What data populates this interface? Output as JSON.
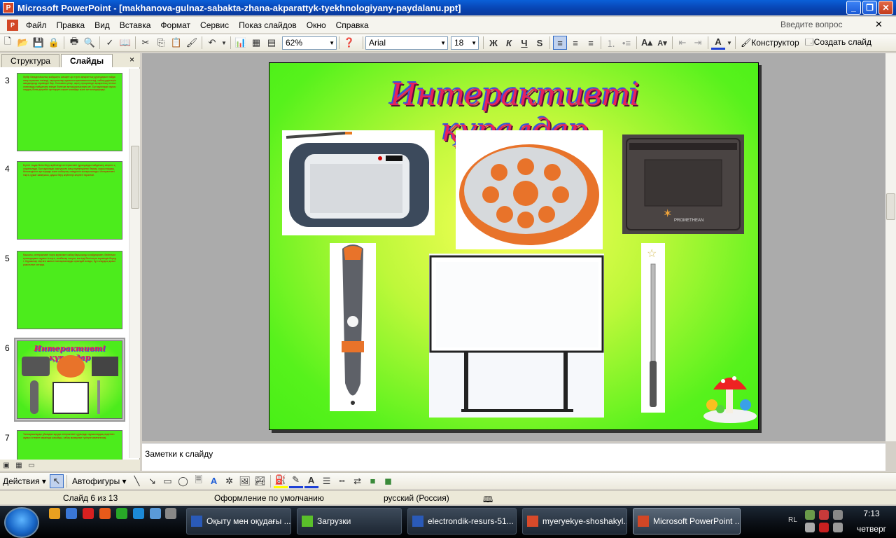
{
  "window": {
    "title": "Microsoft PowerPoint - [makhanova-gulnaz-sabakta-zhana-akparattyk-tyekhnologiyany-paydalanu.ppt]"
  },
  "menu": {
    "items": [
      "Файл",
      "Правка",
      "Вид",
      "Вставка",
      "Формат",
      "Сервис",
      "Показ слайдов",
      "Окно",
      "Справка"
    ],
    "help_placeholder": "Введите вопрос"
  },
  "toolbar": {
    "zoom": "62%",
    "font": "Arial",
    "size": "18",
    "bold": "Ж",
    "italic": "К",
    "underline": "Ч",
    "shadow": "S",
    "designer": "Конструктор",
    "new_slide": "Создать слайд"
  },
  "panel": {
    "tabs": [
      "Структура",
      "Слайды"
    ],
    "close": "×"
  },
  "thumbs": [
    {
      "num": "3",
      "text": "Әрбір бағдарламалық жабдықты шешуге әрі түрлі ақпараттық құралдарын пайдалану ықпалын тигізеді, оқытушылар жұмысын қамтамасыз етеді, сабақ үрдістерін жандандыру мүмкіндігі бар. Сонымен қатар, оқыту процесінде ақпараттық технологияларды пайдалану өзінде бірнеше артықшылықтарға ие. Бұл құралдар оқушылардың білім деңгейін арттыруға ықпал жасайды және ынталандырады."
    },
    {
      "num": "4",
      "text": "Бүгінгі таңда білім беру жүйесінде интерактивті құралдарды пайдалану кеңінен қолданылуда. Бұл құралдар оқытушыға жаңа мүмкіндіктер береді, оқушылардың белсенділігін арттырады және сабақтың тиімділігін жоғарылатады. Интерактивті тақта, құжат камерасы, дауыс беру жүйелері кеңінен таралған."
    },
    {
      "num": "5",
      "text": "Мысалы, интерактивті тақта мұғалімге сабақ барысында слайдтармен, бейнематериалдармен жұмыс істеуге, сызбалар салуға, мәтінді белгілеуге мүмкіндік береді. Оқушылар тақтаға шығып тапсырмаларды орындай алады, бұл олардың қызығушылығын оятады."
    },
    {
      "num": "6",
      "title": "Интерактивті құралдар"
    },
    {
      "num": "7",
      "text": "Тапсырмаларды ұйымдастыруда интерактивті құралдар оқушылардың өздігінен жұмыс істеуіне мүмкіндік жасайды, сабақ мазмұнын түсінуге көмектеседі."
    }
  ],
  "slide": {
    "title": "Интерактивті құралдар"
  },
  "notes": {
    "placeholder": "Заметки к слайду"
  },
  "drawbar": {
    "actions": "Действия",
    "autoshapes": "Автофигуры"
  },
  "status": {
    "slide": "Слайд 6 из 13",
    "design": "Оформление по умолчанию",
    "language": "русский (Россия)"
  },
  "taskbar": {
    "items": [
      "Оқыту мен оқудағы ...",
      "Загрузки",
      "electrondik-resurs-51...",
      "myeryekye-shoshakyl...",
      "Microsoft PowerPoint ..."
    ],
    "lang": "RL",
    "time": "7:13",
    "day": "четверг"
  }
}
